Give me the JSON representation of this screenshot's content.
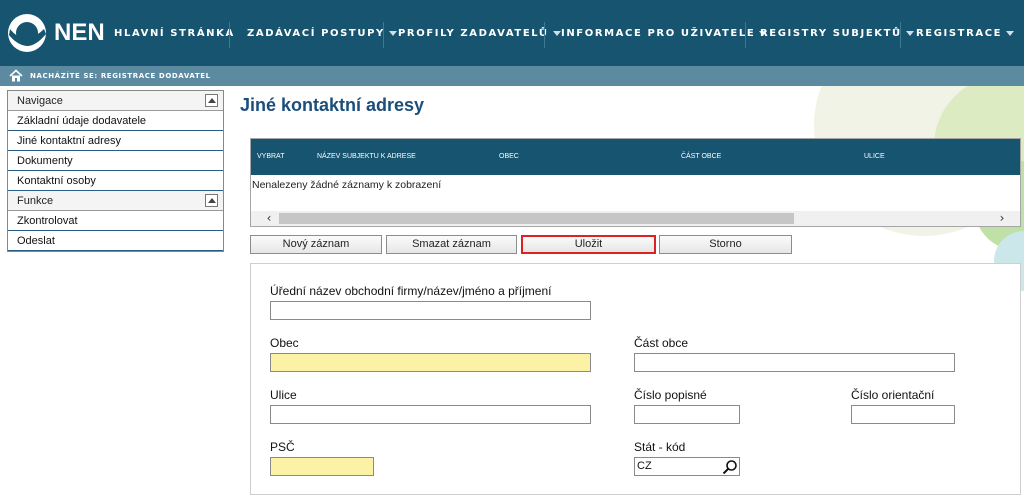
{
  "brand": {
    "logo_text": "NEN"
  },
  "nav": {
    "items": [
      {
        "label": "Hlavní stránka",
        "has_caret": false
      },
      {
        "label": "Zadávací postupy",
        "has_caret": true
      },
      {
        "label": "Profily zadavatelů",
        "has_caret": true
      },
      {
        "label": "Informace pro uživatele",
        "has_caret": true
      },
      {
        "label": "Registry subjektů",
        "has_caret": true
      },
      {
        "label": "Registrace",
        "has_caret": true
      }
    ]
  },
  "breadcrumb": {
    "text": "NACHÁZÍTE SE: REGISTRACE DODAVATEL"
  },
  "sidebar": {
    "navigace": {
      "title": "Navigace",
      "items": [
        "Základní údaje dodavatele",
        "Jiné kontaktní adresy",
        "Dokumenty",
        "Kontaktní osoby"
      ]
    },
    "funkce": {
      "title": "Funkce",
      "items": [
        "Zkontrolovat",
        "Odeslat"
      ]
    }
  },
  "page": {
    "title": "Jiné kontaktní adresy"
  },
  "grid": {
    "columns": [
      "VYBRAT",
      "NÁZEV SUBJEKTU K ADRESE",
      "OBEC",
      "ČÁST OBCE",
      "ULICE"
    ],
    "empty_text": "Nenalezeny žádné záznamy k zobrazení",
    "scroll_left": "‹",
    "scroll_right": "›"
  },
  "buttons": {
    "new": "Nový záznam",
    "delete": "Smazat záznam",
    "save": "Uložit",
    "cancel": "Storno"
  },
  "form": {
    "official_name": {
      "label": "Úřední název obchodní firmy/název/jméno a příjmení",
      "value": ""
    },
    "obec": {
      "label": "Obec",
      "value": ""
    },
    "cast_obce": {
      "label": "Část obce",
      "value": ""
    },
    "ulice": {
      "label": "Ulice",
      "value": ""
    },
    "cislo_popisne": {
      "label": "Číslo popisné",
      "value": ""
    },
    "cislo_orientacni": {
      "label": "Číslo orientační",
      "value": ""
    },
    "psc": {
      "label": "PSČ",
      "value": ""
    },
    "stat": {
      "label": "Stát - kód",
      "value": "CZ"
    }
  },
  "colors": {
    "header": "#17546f",
    "breadcrumb": "#5b8aa1",
    "required_field": "#fbf2a6",
    "title": "#1b4e7a",
    "focus_border": "#dd2222"
  }
}
